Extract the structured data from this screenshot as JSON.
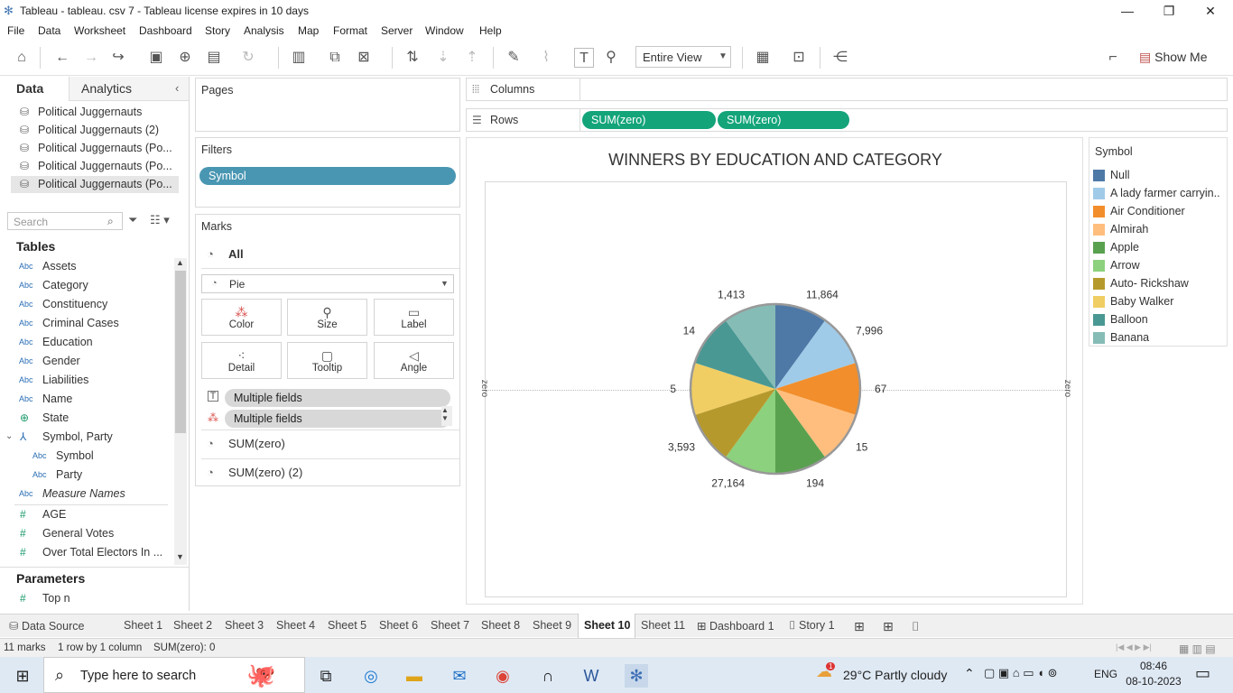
{
  "window": {
    "title": "Tableau - tableau. csv 7 - Tableau license expires in 10 days",
    "app_icon": "tableau-icon"
  },
  "menu": [
    "File",
    "Data",
    "Worksheet",
    "Dashboard",
    "Story",
    "Analysis",
    "Map",
    "Format",
    "Server",
    "Window",
    "Help"
  ],
  "toolbar": {
    "fit": "Entire View",
    "show_me": "Show Me"
  },
  "data_pane": {
    "tabs": [
      "Data",
      "Analytics"
    ],
    "datasources": [
      "Political Juggernauts",
      "Political Juggernauts (2)",
      "Political Juggernauts (Po...",
      "Political Juggernauts (Po...",
      "Political Juggernauts (Po..."
    ],
    "search_placeholder": "Search",
    "tables_header": "Tables",
    "fields": [
      {
        "type": "Abc",
        "name": "Assets"
      },
      {
        "type": "Abc",
        "name": "Category"
      },
      {
        "type": "Abc",
        "name": "Constituency"
      },
      {
        "type": "Abc",
        "name": "Criminal Cases"
      },
      {
        "type": "Abc",
        "name": "Education"
      },
      {
        "type": "Abc",
        "name": "Gender"
      },
      {
        "type": "Abc",
        "name": "Liabilities"
      },
      {
        "type": "Abc",
        "name": "Name"
      },
      {
        "type": "globe",
        "name": "State"
      },
      {
        "type": "hier",
        "name": "Symbol, Party"
      },
      {
        "type": "Abc",
        "name": "Symbol"
      },
      {
        "type": "Abc",
        "name": "Party"
      },
      {
        "type": "Abc",
        "name": "Measure Names"
      },
      {
        "type": "#",
        "name": "AGE"
      },
      {
        "type": "#",
        "name": "General Votes"
      },
      {
        "type": "#",
        "name": "Over Total Electors In ..."
      }
    ],
    "parameters_header": "Parameters",
    "parameters": [
      {
        "type": "#",
        "name": "Top n"
      }
    ]
  },
  "shelves": {
    "pages": "Pages",
    "filters": "Filters",
    "filter_pills": [
      "Symbol"
    ],
    "columns": "Columns",
    "rows": "Rows",
    "row_pills": [
      "SUM(zero)",
      "SUM(zero)"
    ]
  },
  "marks": {
    "title": "Marks",
    "all": "All",
    "type": "Pie",
    "buttons": [
      "Color",
      "Size",
      "Label",
      "Detail",
      "Tooltip",
      "Angle"
    ],
    "fields": [
      "Multiple fields",
      "Multiple fields"
    ],
    "measures": [
      "SUM(zero)",
      "SUM(zero) (2)"
    ]
  },
  "viz": {
    "title": "WINNERS BY EDUCATION AND CATEGORY",
    "axis_left": "zero",
    "axis_right": "zero"
  },
  "legend": {
    "title": "Symbol",
    "items": [
      {
        "label": "Null",
        "color": "#4e79a7"
      },
      {
        "label": "A lady farmer carryin..",
        "color": "#a0cbe8"
      },
      {
        "label": "Air Conditioner",
        "color": "#f28e2b"
      },
      {
        "label": "Almirah",
        "color": "#ffbe7d"
      },
      {
        "label": "Apple",
        "color": "#59a14f"
      },
      {
        "label": "Arrow",
        "color": "#8cd17d"
      },
      {
        "label": "Auto- Rickshaw",
        "color": "#b6992d"
      },
      {
        "label": "Baby Walker",
        "color": "#f1ce63"
      },
      {
        "label": "Balloon",
        "color": "#499894"
      },
      {
        "label": "Banana",
        "color": "#86bcb6"
      }
    ]
  },
  "chart_data": {
    "type": "pie",
    "title": "WINNERS BY EDUCATION AND CATEGORY",
    "slices": [
      {
        "name": "Null",
        "label": "11,864",
        "color": "#4e79a7"
      },
      {
        "name": "A lady farmer carryin..",
        "label": "7,996",
        "color": "#a0cbe8"
      },
      {
        "name": "Air Conditioner",
        "label": "67",
        "color": "#f28e2b"
      },
      {
        "name": "Almirah",
        "label": "15",
        "color": "#ffbe7d"
      },
      {
        "name": "Apple",
        "label": "194",
        "color": "#59a14f"
      },
      {
        "name": "Arrow",
        "label": "27,164",
        "color": "#8cd17d"
      },
      {
        "name": "Auto- Rickshaw",
        "label": "3,593",
        "color": "#b6992d"
      },
      {
        "name": "Baby Walker",
        "label": "5",
        "color": "#f1ce63"
      },
      {
        "name": "Balloon",
        "label": "14",
        "color": "#499894"
      },
      {
        "name": "Banana",
        "label": "1,413",
        "color": "#86bcb6"
      }
    ],
    "legend_position": "right"
  },
  "sheet_tabs": [
    "Data Source",
    "Sheet 1",
    "Sheet 2",
    "Sheet 3",
    "Sheet 4",
    "Sheet 5",
    "Sheet 6",
    "Sheet 7",
    "Sheet 8",
    "Sheet 9",
    "Sheet 10",
    "Sheet 11",
    "Dashboard 1",
    "Story 1"
  ],
  "active_tab": "Sheet 10",
  "status": {
    "marks": "11 marks",
    "rows_cols": "1 row by 1 column",
    "sum": "SUM(zero): 0"
  },
  "taskbar": {
    "search_placeholder": "Type here to search",
    "weather": "29°C  Partly cloudy",
    "lang": "ENG",
    "time": "08:46",
    "date": "08-10-2023",
    "notif_badge": "1"
  }
}
